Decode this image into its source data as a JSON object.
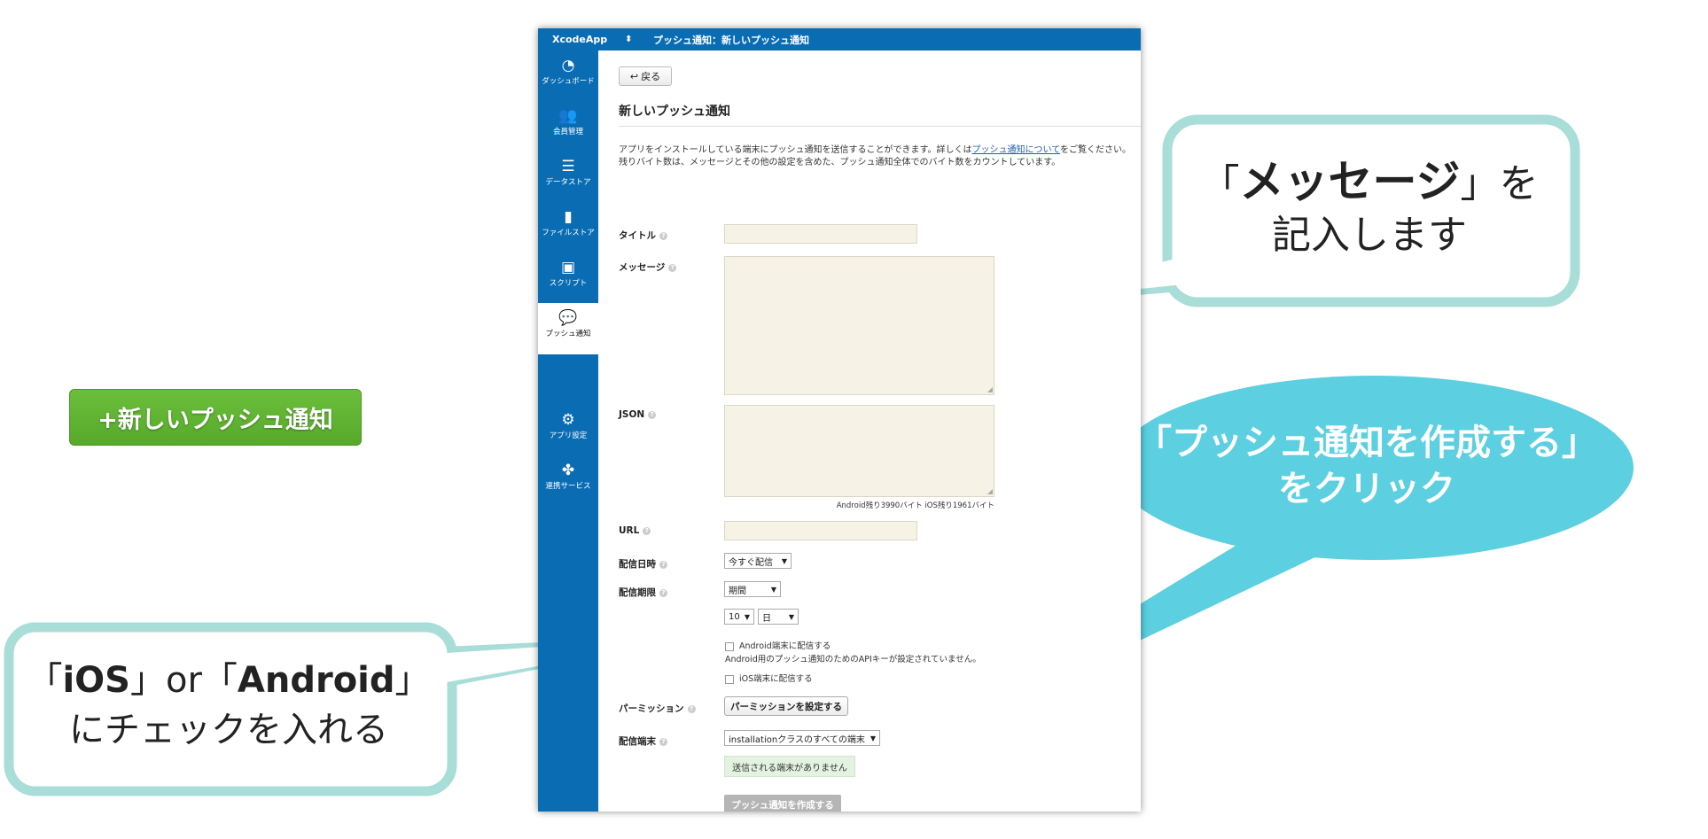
{
  "new_push_button": "+新しいプッシュ通知",
  "topbar": {
    "app_name": "XcodeApp",
    "switch_icon": "⬍",
    "breadcrumb": "プッシュ通知：新しいプッシュ通知"
  },
  "sidebar": {
    "items": [
      {
        "label": "ダッシュボード",
        "icon": "dashboard-icon"
      },
      {
        "label": "会員管理",
        "icon": "users-icon"
      },
      {
        "label": "データストア",
        "icon": "datastore-icon"
      },
      {
        "label": "ファイルストア",
        "icon": "file-icon"
      },
      {
        "label": "スクリプト",
        "icon": "script-icon"
      },
      {
        "label": "プッシュ通知",
        "icon": "chat-bubble-icon",
        "active": true
      },
      {
        "label": "アプリ設定",
        "icon": "gears-icon"
      },
      {
        "label": "連携サービス",
        "icon": "integrations-icon"
      }
    ]
  },
  "main": {
    "back_label": "戻る",
    "page_title": "新しいプッシュ通知",
    "desc": {
      "line1_pre": "アプリをインストールしている端末にプッシュ通知を送信することができます。詳しくは",
      "link": "プッシュ通知について",
      "line1_post": "をご覧ください。",
      "line2": "残りバイト数は、メッセージとその他の設定を含めた、プッシュ通知全体でのバイト数をカウントしています。"
    },
    "labels": {
      "title": "タイトル",
      "message": "メッセージ",
      "json": "JSON",
      "url": "URL",
      "delivery_time": "配信日時",
      "delivery_period": "配信期限",
      "permission": "パーミッション",
      "target": "配信端末"
    },
    "help_glyph": "?",
    "byte_count": "Android残り3990バイト iOS残り1961バイト",
    "delivery_time_value": "今すぐ配信",
    "delivery_period_value": "期間",
    "period_number": "10",
    "period_unit": "日",
    "android_checkbox": "Android端末に配信する",
    "android_note": "Android用のプッシュ通知のためのAPIキーが設定されていません。",
    "ios_checkbox": "iOS端末に配信する",
    "permission_button": "パーミッションを設定する",
    "target_value": "installationクラスのすべての端末",
    "no_devices": "送信される端末がありません",
    "create_button": "プッシュ通知を作成する"
  },
  "callouts": {
    "message": {
      "open": "「",
      "bold": "メッセージ",
      "close": "」を",
      "line2": "記入します"
    },
    "create": {
      "line1": "「プッシュ通知を作成する」",
      "line2": "をクリック"
    },
    "os": {
      "open1": "「",
      "bold1": "iOS",
      "mid": "」or「",
      "bold2": "Android",
      "close": "」",
      "line2": "にチェックを入れる"
    }
  },
  "colors": {
    "sidebar": "#0a6db4",
    "green": "#5fb232",
    "callout_border": "#a8ddd8",
    "ellipse": "#5ccfe0"
  }
}
